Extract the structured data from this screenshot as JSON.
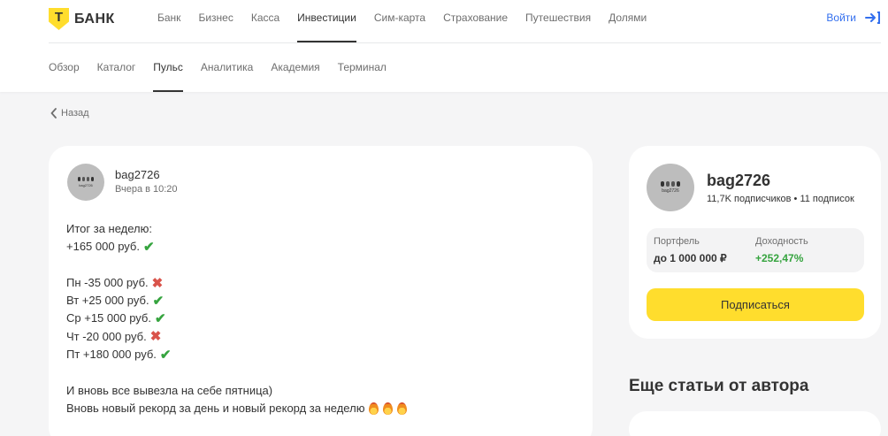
{
  "brand": {
    "mark": "Т",
    "name": "БАНК"
  },
  "main_nav": [
    {
      "label": "Банк",
      "active": false
    },
    {
      "label": "Бизнес",
      "active": false
    },
    {
      "label": "Касса",
      "active": false
    },
    {
      "label": "Инвестиции",
      "active": true
    },
    {
      "label": "Сим-карта",
      "active": false
    },
    {
      "label": "Страхование",
      "active": false
    },
    {
      "label": "Путешествия",
      "active": false
    },
    {
      "label": "Долями",
      "active": false
    }
  ],
  "login": {
    "label": "Войти",
    "icon": "login-arrow-icon",
    "color": "#336fee"
  },
  "sub_nav": [
    {
      "label": "Обзор",
      "active": false
    },
    {
      "label": "Каталог",
      "active": false
    },
    {
      "label": "Пульс",
      "active": true
    },
    {
      "label": "Аналитика",
      "active": false
    },
    {
      "label": "Академия",
      "active": false
    },
    {
      "label": "Терминал",
      "active": false
    }
  ],
  "back": {
    "label": "Назад",
    "icon": "chevron-left-icon"
  },
  "post": {
    "author": "bag2726",
    "avatar_text": "bag2726",
    "time": "Вчера в 10:20",
    "lines": {
      "l1": "Итог за неделю:",
      "l2": "+165 000 руб.",
      "l3": "Пн -35 000 руб.",
      "l4": "Вт +25 000 руб.",
      "l5": "Ср +15 000 руб.",
      "l6": "Чт -20 000 руб.",
      "l7": "Пт +180 000 руб.",
      "l8": "И вновь все вывезла на себе пятница)",
      "l9": "Вновь новый рекорд за день и новый рекорд за неделю"
    },
    "marks": {
      "check": "✔",
      "cross": "✖"
    }
  },
  "profile": {
    "name": "bag2726",
    "avatar_text": "bag2726",
    "subs": "11,7K подписчиков • 11 подписок",
    "portfolio_label": "Портфель",
    "portfolio_value": "до 1 000 000 ₽",
    "yield_label": "Доходность",
    "yield_value": "+252,47%",
    "subscribe_label": "Подписаться"
  },
  "more_title": "Еще статьи от автора",
  "colors": {
    "accent": "#ffdd2d",
    "positive": "#36a43f",
    "negative": "#d9534a",
    "link": "#336fee"
  }
}
